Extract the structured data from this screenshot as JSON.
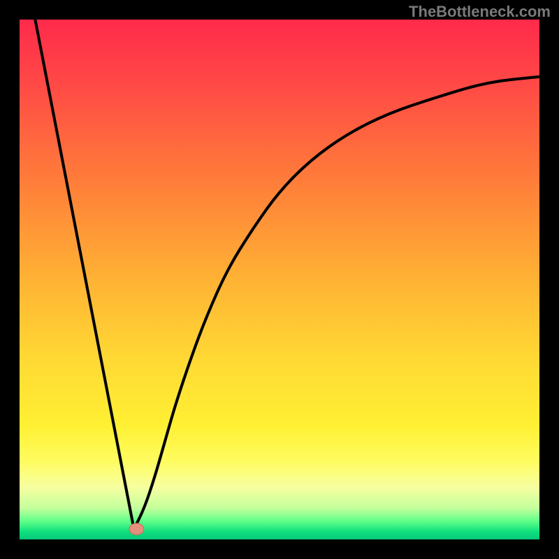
{
  "watermark": "TheBottleneck.com",
  "colors": {
    "bg_black": "#000000",
    "curve": "#000000",
    "marker_fill": "#e58f7d",
    "marker_stroke": "#cc6f5c"
  },
  "chart_data": {
    "type": "line",
    "title": "",
    "xlabel": "",
    "ylabel": "",
    "xlim": [
      0,
      100
    ],
    "ylim": [
      0,
      100
    ],
    "grid": false,
    "legend": false,
    "gradient_stops": [
      {
        "offset": 0.0,
        "color": "#ff2a4b"
      },
      {
        "offset": 0.12,
        "color": "#ff4846"
      },
      {
        "offset": 0.3,
        "color": "#ff7a3a"
      },
      {
        "offset": 0.5,
        "color": "#ffb234"
      },
      {
        "offset": 0.65,
        "color": "#ffd834"
      },
      {
        "offset": 0.78,
        "color": "#fff033"
      },
      {
        "offset": 0.85,
        "color": "#fffc60"
      },
      {
        "offset": 0.9,
        "color": "#f6ffa0"
      },
      {
        "offset": 0.94,
        "color": "#c3ff9c"
      },
      {
        "offset": 0.965,
        "color": "#5fff88"
      },
      {
        "offset": 0.985,
        "color": "#10e07e"
      },
      {
        "offset": 1.0,
        "color": "#06c87a"
      }
    ],
    "series": [
      {
        "name": "left-linear-segment",
        "x": [
          3,
          22
        ],
        "y": [
          100,
          2
        ]
      },
      {
        "name": "right-curve",
        "x": [
          22,
          24,
          26,
          28,
          30,
          33,
          36,
          40,
          45,
          50,
          56,
          63,
          71,
          80,
          90,
          100
        ],
        "y": [
          2,
          6,
          12,
          19,
          26,
          35,
          43,
          52,
          60,
          67,
          73,
          78,
          82,
          85,
          88,
          89
        ]
      }
    ],
    "marker": {
      "x": 22.5,
      "y": 2,
      "rx": 1.4,
      "ry": 1.1
    }
  }
}
